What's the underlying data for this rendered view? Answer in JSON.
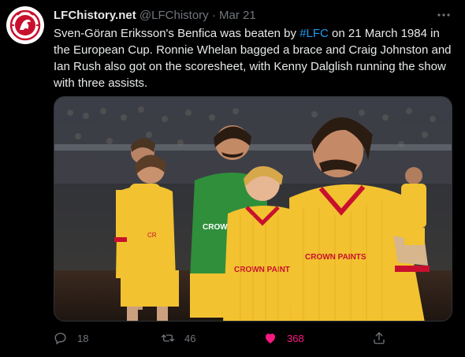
{
  "tweet": {
    "author_name": "LFChistory.net",
    "handle": "@LFChistory",
    "separator": "·",
    "date": "Mar 21",
    "text_part1": "Sven-Göran Eriksson's Benfica was beaten by ",
    "hashtag": "#LFC",
    "text_part2": " on 21 March 1984 in the  European Cup. Ronnie Whelan bagged a brace and Craig Johnston and Ian Rush also got on the scoresheet, with Kenny Dalglish running the show with three assists.",
    "media_alt": "",
    "shirt_sponsor": "CROWN PAINTS"
  },
  "actions": {
    "reply_count": "18",
    "retweet_count": "46",
    "like_count": "368"
  },
  "colors": {
    "background": "#000000",
    "text": "#e7e9ea",
    "muted": "#71767b",
    "link": "#1d9bf0",
    "like": "#f91880",
    "kit_yellow": "#f2c230",
    "kit_red": "#c8102e",
    "keeper_green": "#2f8f3a"
  },
  "icons": {
    "more": "more-dots-icon",
    "reply": "reply-icon",
    "retweet": "retweet-icon",
    "like": "heart-filled-icon",
    "share": "share-icon",
    "avatar": "lfc-crest-icon"
  }
}
